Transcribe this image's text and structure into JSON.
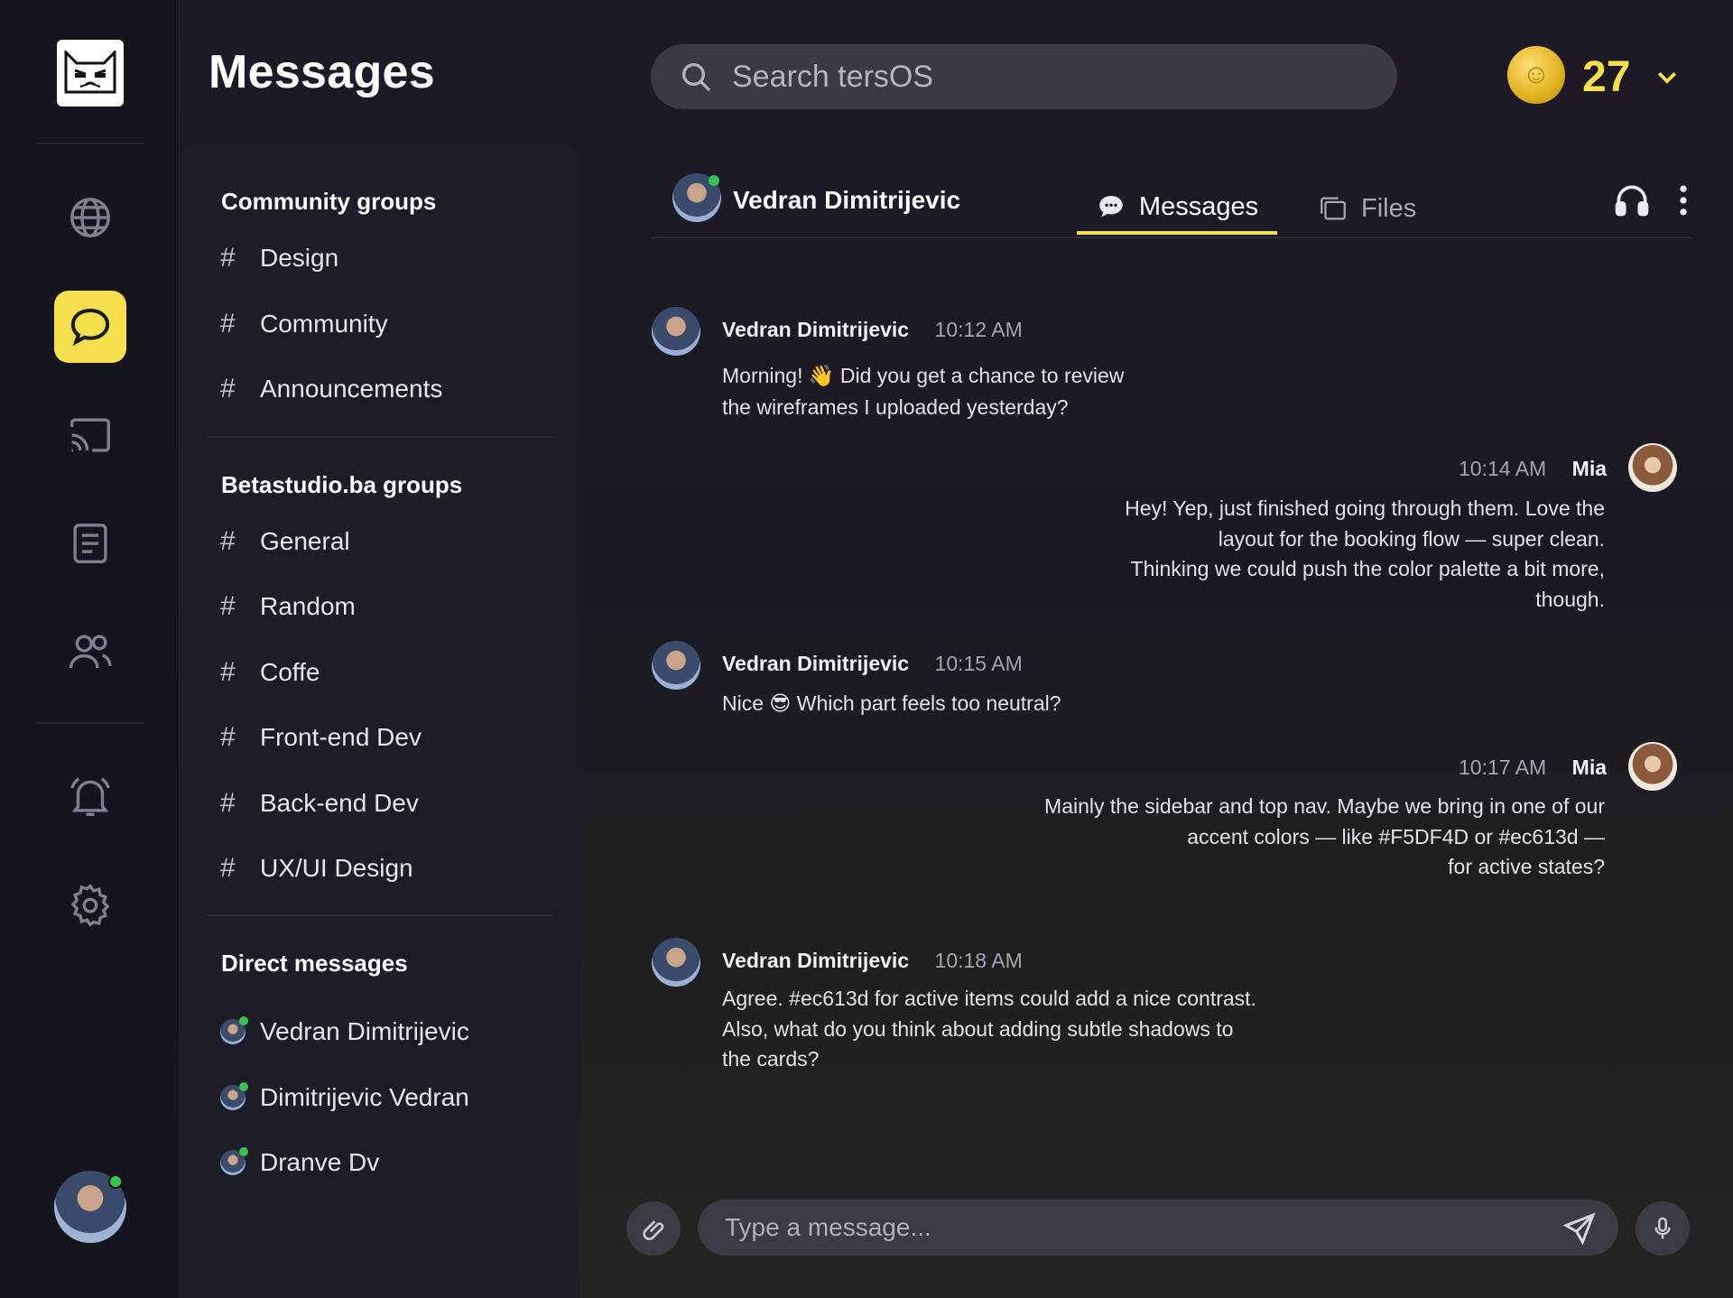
{
  "app": {
    "title": "Messages"
  },
  "search": {
    "placeholder": "Search tersOS"
  },
  "coins": {
    "count": "27"
  },
  "community_groups": {
    "title": "Community groups",
    "items": [
      "Design",
      "Community",
      "Announcements"
    ]
  },
  "beta_groups": {
    "title": "Betastudio.ba groups",
    "items": [
      "General",
      "Random",
      "Coffe",
      "Front-end Dev",
      "Back-end Dev",
      "UX/UI Design"
    ]
  },
  "direct_messages": {
    "title": "Direct messages",
    "items": [
      "Vedran Dimitrijevic",
      "Dimitrijevic Vedran",
      "Dranve Dv"
    ]
  },
  "chat": {
    "contact": "Vedran Dimitrijevic",
    "tabs": {
      "messages": "Messages",
      "files": "Files"
    },
    "messages": [
      {
        "sender": "Vedran Dimitrijevic",
        "time": "10:12 AM",
        "text": "Morning! 👋 Did you get a chance to review\nthe wireframes I uploaded yesterday?"
      },
      {
        "sender": "Mia",
        "time": "10:14 AM",
        "text": "Hey! Yep, just finished going through them. Love the\nlayout for the booking flow — super clean.\nThinking we could push the color palette a bit more,\nthough."
      },
      {
        "sender": "Vedran Dimitrijevic",
        "time": "10:15 AM",
        "text": "Nice 😎 Which part feels too neutral?"
      },
      {
        "sender": "Mia",
        "time": "10:17 AM",
        "text": "Mainly the sidebar and top nav. Maybe we bring in one of our\naccent colors — like #F5DF4D or #ec613d —\nfor active states?"
      },
      {
        "sender": "Vedran Dimitrijevic",
        "time": "10:18 AM",
        "text": "Agree. #ec613d for active items could add a nice contrast.\n Also, what do you think about adding subtle shadows to\nthe cards?"
      }
    ]
  },
  "composer": {
    "placeholder": "Type a message..."
  },
  "colors": {
    "accent": "#f5df4d",
    "online": "#38c24f",
    "background": "#1d1a27"
  }
}
